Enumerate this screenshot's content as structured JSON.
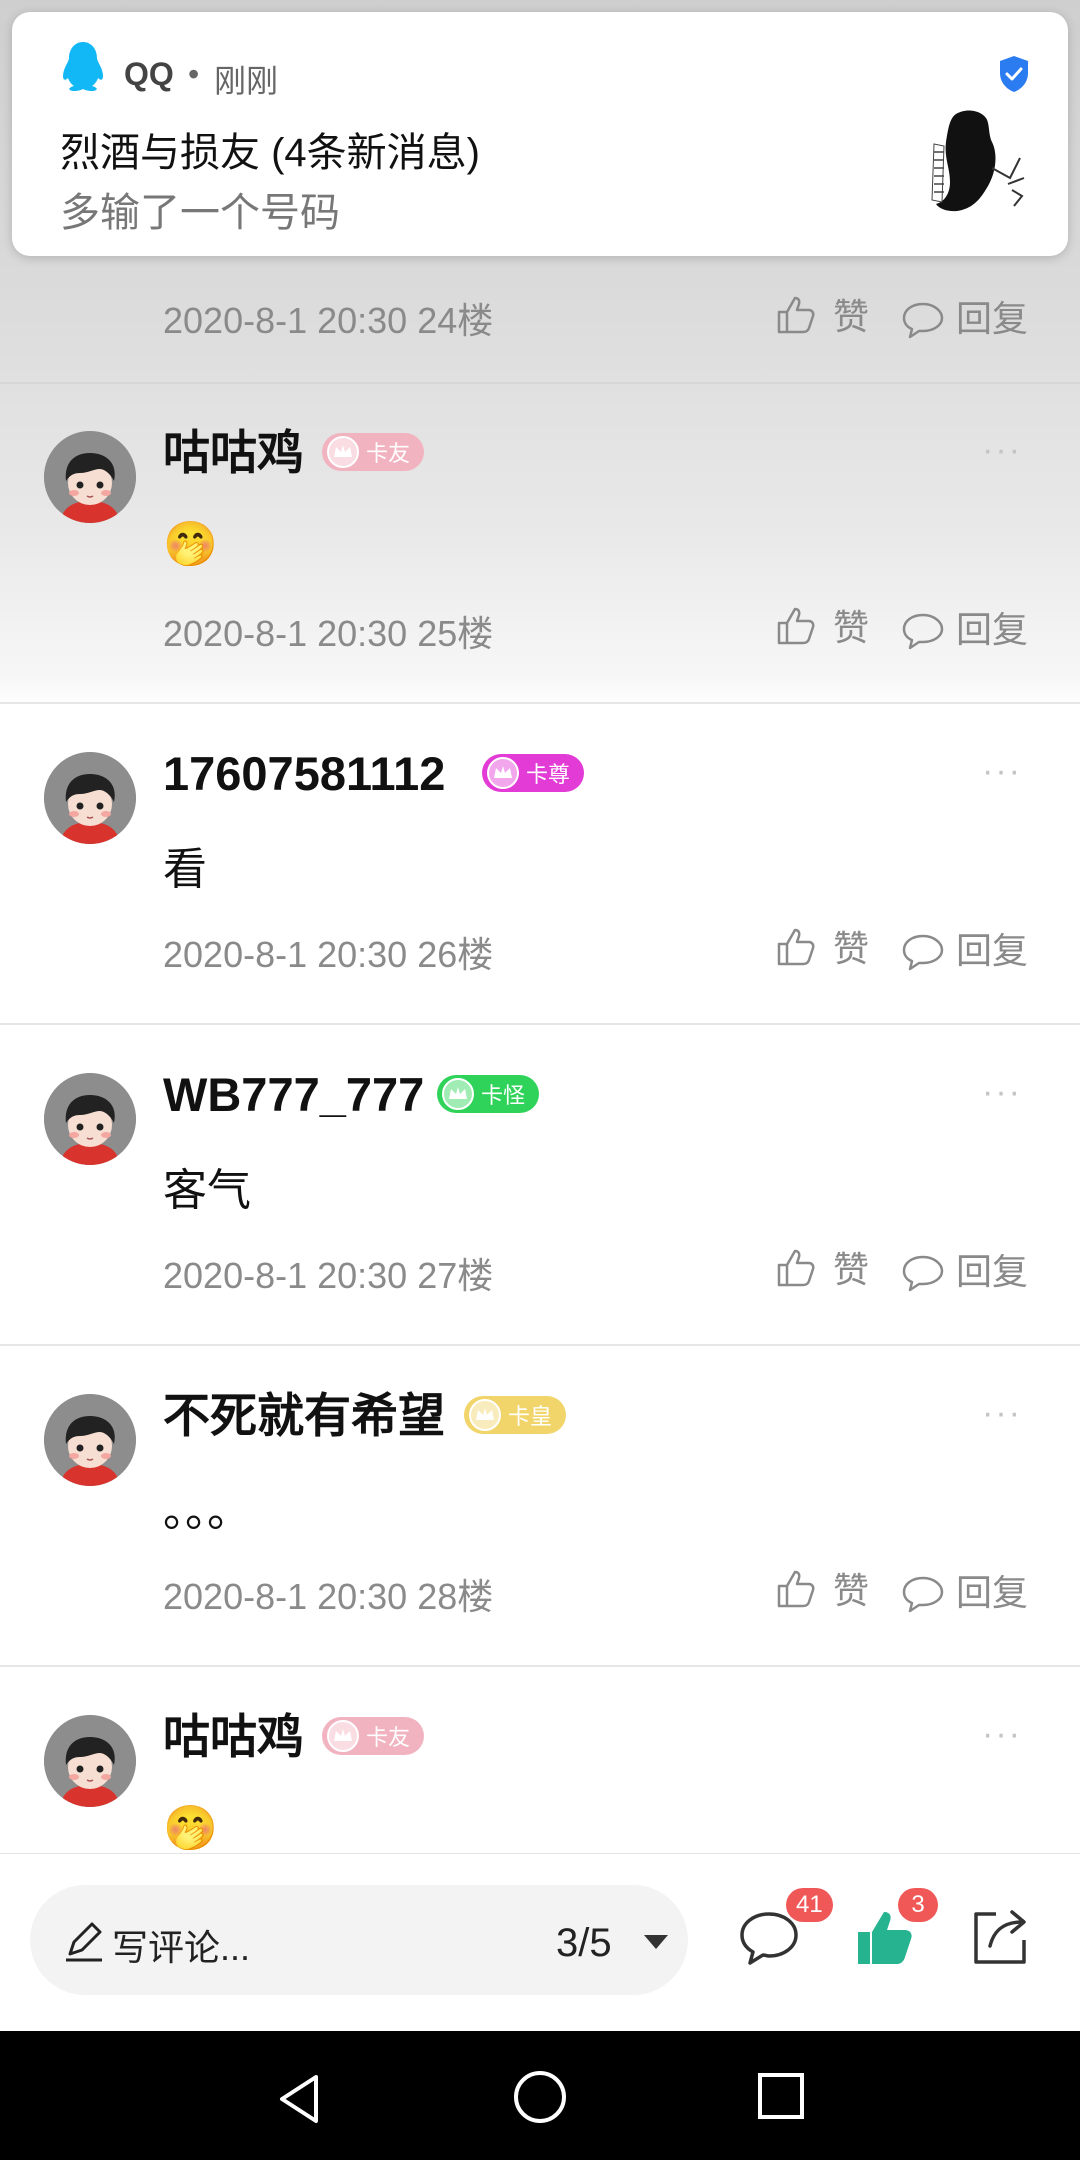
{
  "notification": {
    "app": "QQ",
    "separator": "•",
    "time": "刚刚",
    "title": "烈酒与损友 (4条新消息)",
    "message": "多输了一个号码",
    "icons": [
      "qq-penguin-icon",
      "verified-shield-icon",
      "contact-avatar"
    ]
  },
  "previous_comment": {
    "meta": "2020-8-1 20:30  24楼",
    "like_label": "赞",
    "reply_label": "回复"
  },
  "comments": [
    {
      "username": "咕咕鸡",
      "badge_text": "卡友",
      "badge_color": "#f2b3c1",
      "content": "🤭",
      "meta": "2020-8-1 20:30  25楼",
      "like_label": "赞",
      "reply_label": "回复"
    },
    {
      "username": "17607581112",
      "badge_text": "卡尊",
      "badge_color": "#e23bd6",
      "content": "看",
      "meta": "2020-8-1 20:30  26楼",
      "like_label": "赞",
      "reply_label": "回复"
    },
    {
      "username": "WB777_777",
      "badge_text": "卡怪",
      "badge_color": "#2fd35a",
      "content": "客气",
      "meta": "2020-8-1 20:30  27楼",
      "like_label": "赞",
      "reply_label": "回复"
    },
    {
      "username": "不死就有希望",
      "badge_text": "卡皇",
      "badge_color": "#f1d56a",
      "content": "。。。",
      "meta": "2020-8-1 20:30  28楼",
      "like_label": "赞",
      "reply_label": "回复"
    },
    {
      "username": "咕咕鸡",
      "badge_text": "卡友",
      "badge_color": "#f2b3c1",
      "content": "🤭",
      "meta": "",
      "like_label": "",
      "reply_label": ""
    }
  ],
  "more_glyph": "···",
  "bottom_bar": {
    "compose_placeholder": "写评论...",
    "page_indicator": "3/5",
    "comment_count": "41",
    "like_count": "3",
    "icons": [
      "pencil-icon",
      "caret-down-icon",
      "comment-icon",
      "thumbs-up-icon",
      "share-icon"
    ],
    "accent_color": "#26b38f"
  },
  "system_nav": {
    "icons": [
      "back-icon",
      "home-icon",
      "recents-icon"
    ]
  }
}
